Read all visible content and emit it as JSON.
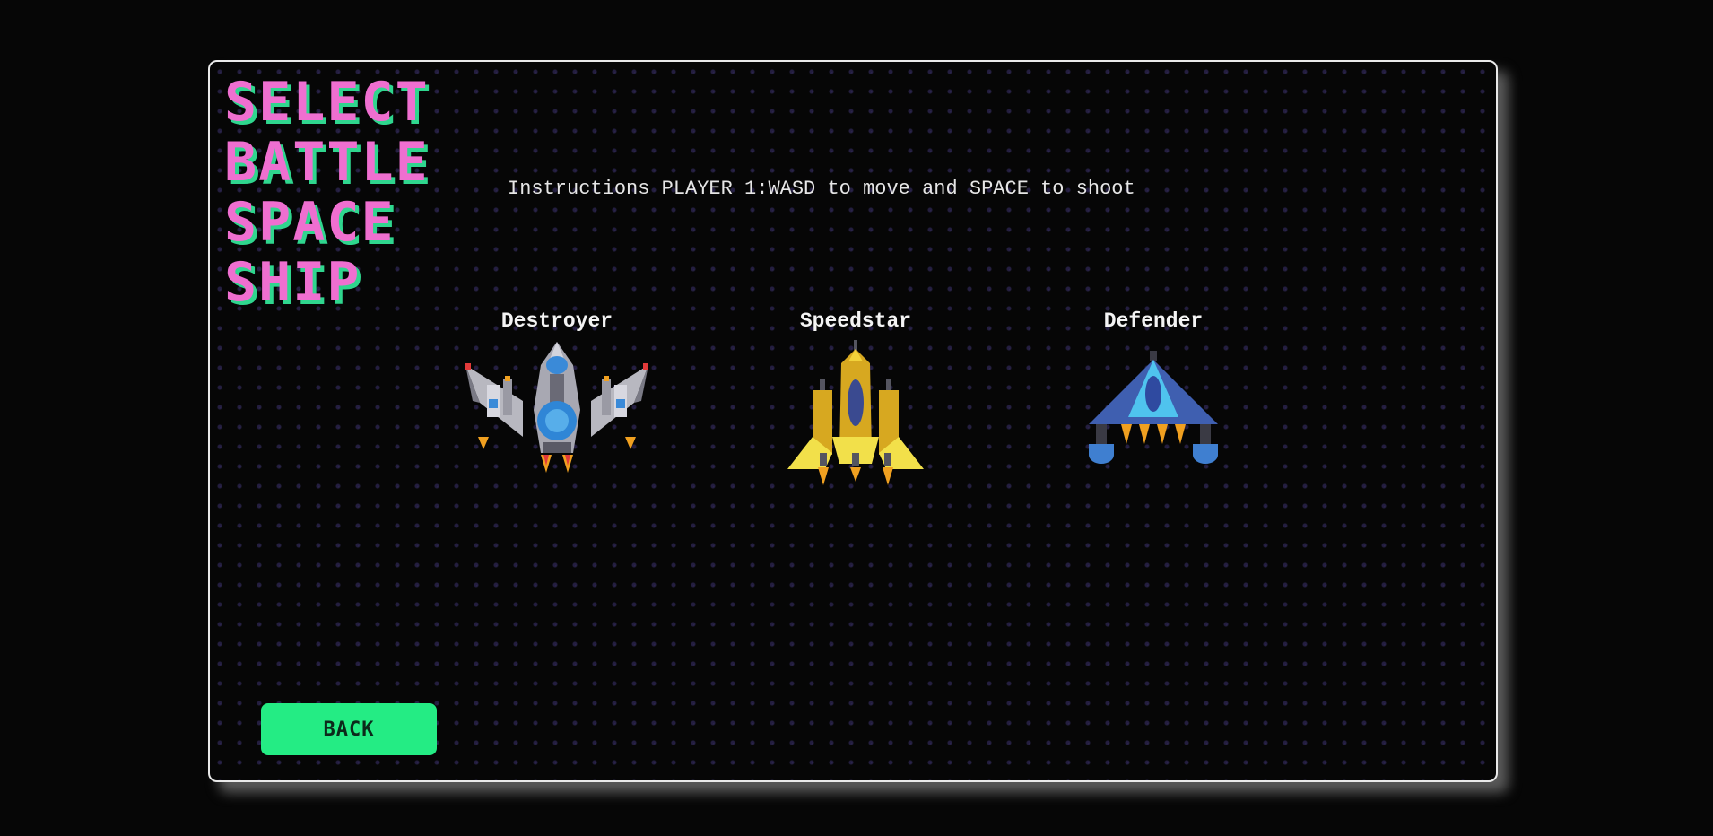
{
  "title": {
    "lines": [
      "SELECT",
      "BATTLE",
      "SPACE",
      "SHIP"
    ],
    "color": "#ef6fd0",
    "shadow_color": "#2fd68e"
  },
  "instructions": "Instructions PLAYER 1:WASD to move and SPACE to shoot",
  "ships": [
    {
      "name": "Destroyer",
      "icon": "destroyer-ship-icon"
    },
    {
      "name": "Speedstar",
      "icon": "speedstar-ship-icon"
    },
    {
      "name": "Defender",
      "icon": "defender-ship-icon"
    }
  ],
  "back_button": {
    "label": "BACK",
    "color": "#24ec84"
  }
}
